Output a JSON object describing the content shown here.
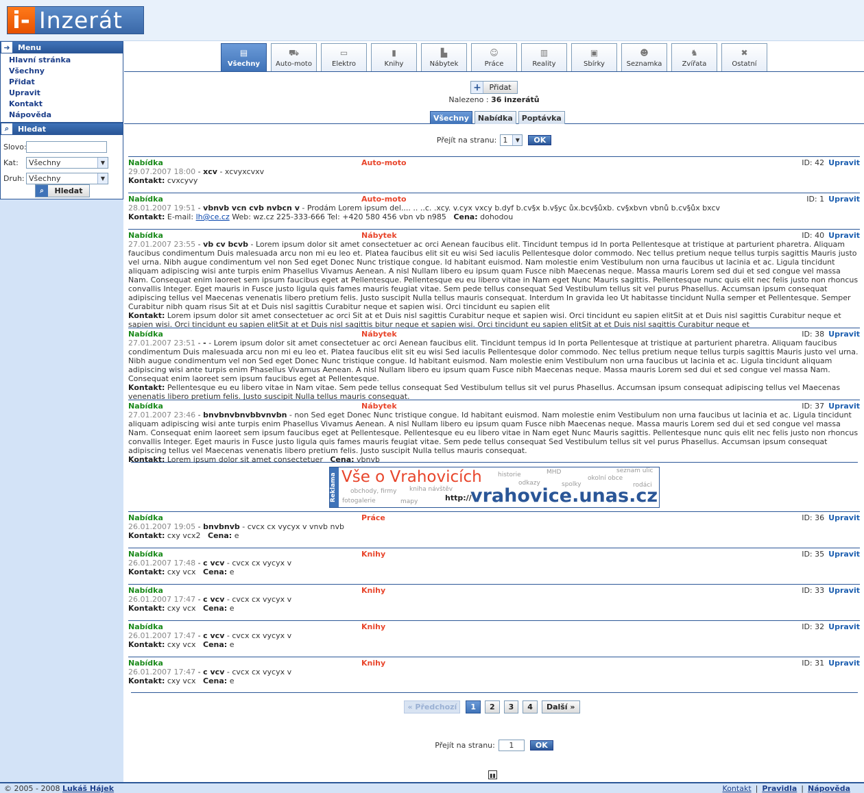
{
  "logo": {
    "mark": "i-",
    "text": "Inzerát"
  },
  "menu": {
    "title": "Menu",
    "items": [
      "Hlavní stránka",
      "Všechny",
      "Přidat",
      "Upravit",
      "Kontakt",
      "Nápověda"
    ]
  },
  "search": {
    "title": "Hledat",
    "word_label": "Slovo:",
    "word_value": "",
    "cat_label": "Kat:",
    "cat_value": "Všechny",
    "type_label": "Druh:",
    "type_value": "Všechny",
    "button": "Hledat"
  },
  "categories": [
    "Všechny",
    "Auto-moto",
    "Elektro",
    "Knihy",
    "Nábytek",
    "Práce",
    "Reality",
    "Sbírky",
    "Seznamka",
    "Zvířata",
    "Ostatní"
  ],
  "add_button": "Přidat",
  "found": {
    "label": "Nalezeno :",
    "value": "36 inzerátů"
  },
  "type_tabs": [
    "Všechny",
    "Nabídka",
    "Poptávka"
  ],
  "pager_top": {
    "label": "Přejít na stranu:",
    "value": "1",
    "ok": "OK"
  },
  "pager_bottom": {
    "label": "Přejít na stranu:",
    "value": "1",
    "ok": "OK",
    "prev": "« Předchozí",
    "next": "Další »",
    "pages": [
      "1",
      "2",
      "3",
      "4"
    ]
  },
  "ads": [
    {
      "type": "Nabídka",
      "cat": "Auto-moto",
      "id": "ID: 42",
      "edit": "Upravit",
      "date": "29.07.2007 18:00",
      "title": "xcv",
      "text": " - xcvyxcvxv",
      "contact_label": "Kontakt:",
      "contact": " cvxcyvy",
      "price_label": "",
      "price": ""
    },
    {
      "type": "Nabídka",
      "cat": "Auto-moto",
      "id": "ID: 1",
      "edit": "Upravit",
      "date": "28.01.2007 19:51",
      "title": "vbnvb vcn cvb nvbcn v",
      "text": " - Prodám Lorem ipsum del.... .. ..c. .xcy. v.cyx vxcy b.dyf b.cv§x b.v§yc ůx.bcv§ůxb. cv§xbvn vbnů b.cv§ůx bxcv",
      "contact_label": "Kontakt:",
      "contact_pre": " E-mail: ",
      "email": "lh@ce.cz",
      "contact": " Web: wz.cz 225-333-666 Tel: +420 580 456 vbn vb n985",
      "price_label": "Cena:",
      "price": " dohodou"
    },
    {
      "type": "Nabídka",
      "cat": "Nábytek",
      "id": "ID: 40",
      "edit": "Upravit",
      "date": "27.01.2007 23:55",
      "title": "vb cv bcvb",
      "text": " - Lorem ipsum dolor sit amet consectetuer ac orci Aenean faucibus elit. Tincidunt tempus id In porta Pellentesque at tristique at parturient pharetra. Aliquam faucibus condimentum Duis malesuada arcu non mi eu leo et. Platea faucibus elit sit eu wisi Sed iaculis Pellentesque dolor commodo. Nec tellus pretium neque tellus turpis sagittis Mauris justo vel urna. Nibh augue condimentum vel non Sed eget Donec Nunc tristique congue. Id habitant euismod. Nam molestie enim Vestibulum non urna faucibus ut lacinia et ac. Ligula tincidunt aliquam adipiscing wisi ante turpis enim Phasellus Vivamus Aenean. A nisl Nullam libero eu ipsum quam Fusce nibh Maecenas neque. Massa mauris Lorem sed dui et sed congue vel massa Nam. Consequat enim laoreet sem ipsum faucibus eget at Pellentesque. Pellentesque eu eu libero vitae in Nam eget Nunc Mauris sagittis. Pellentesque nunc quis elit nec felis justo non rhoncus convallis Integer. Eget mauris in Fusce justo ligula quis fames mauris feugiat vitae. Sem pede tellus consequat Sed Vestibulum tellus sit vel purus Phasellus. Accumsan ipsum consequat adipiscing tellus vel Maecenas venenatis libero pretium felis. Justo suscipit Nulla tellus mauris consequat. Interdum In gravida leo Ut habitasse tincidunt Nulla semper et Pellentesque. Semper Curabitur nibh quam risus Sit at et Duis nisl sagittis Curabitur neque et sapien wisi. Orci tincidunt eu sapien elit",
      "contact_label": "Kontakt:",
      "contact": " Lorem ipsum dolor sit amet consectetuer ac orci Sit at et Duis nisl sagittis Curabitur neque et sapien wisi. Orci tincidunt eu sapien elitSit at et Duis nisl sagittis Curabitur neque et sapien wisi. Orci tincidunt eu sapien elitSit at et Duis nisl sagittis bitur neque et sapien wisi. Orci tincidunt eu sapien elitSit at et Duis nisl sagittis Curabitur neque et",
      "price_label": "",
      "price": ""
    },
    {
      "type": "Nabídka",
      "cat": "Nábytek",
      "id": "ID: 38",
      "edit": "Upravit",
      "date": "27.01.2007 23:51",
      "title": "-",
      "text": " - Lorem ipsum dolor sit amet consectetuer ac orci Aenean faucibus elit. Tincidunt tempus id In porta Pellentesque at tristique at parturient pharetra. Aliquam faucibus condimentum Duis malesuada arcu non mi eu leo et. Platea faucibus elit sit eu wisi Sed iaculis Pellentesque dolor commodo. Nec tellus pretium neque tellus turpis sagittis Mauris justo vel urna. Nibh augue condimentum vel non Sed eget Donec Nunc tristique congue. Id habitant euismod. Nam molestie enim Vestibulum non urna faucibus ut lacinia et ac. Ligula tincidunt aliquam adipiscing wisi ante turpis enim Phasellus Vivamus Aenean. A nisl Nullam libero eu ipsum quam Fusce nibh Maecenas neque. Massa mauris Lorem sed dui et sed congue vel massa Nam. Consequat enim laoreet sem ipsum faucibus eget at Pellentesque.",
      "contact_label": "Kontakt:",
      "contact": " Pellentesque eu eu libero vitae in Nam vitae. Sem pede tellus consequat Sed Vestibulum tellus sit vel purus Phasellus. Accumsan ipsum consequat adipiscing tellus vel Maecenas venenatis libero pretium felis. Justo suscipit Nulla tellus mauris consequat.",
      "price_label": "",
      "price": ""
    },
    {
      "type": "Nabídka",
      "cat": "Nábytek",
      "id": "ID: 37",
      "edit": "Upravit",
      "date": "27.01.2007 23:46",
      "title": "bnvbnvbnvbbvnvbn",
      "text": " - non Sed eget Donec Nunc tristique congue. Id habitant euismod. Nam molestie enim Vestibulum non urna faucibus ut lacinia et ac. Ligula tincidunt aliquam adipiscing wisi ante turpis enim Phasellus Vivamus Aenean. A nisl Nullam libero eu ipsum quam Fusce nibh Maecenas neque. Massa mauris Lorem sed dui et sed congue vel massa Nam. Consequat enim laoreet sem ipsum faucibus eget at Pellentesque. Pellentesque eu eu libero vitae in Nam eget Nunc Mauris sagittis. Pellentesque nunc quis elit nec felis justo non rhoncus convallis Integer. Eget mauris in Fusce justo ligula quis fames mauris feugiat vitae. Sem pede tellus consequat Sed Vestibulum tellus sit vel purus Phasellus. Accumsan ipsum consequat adipiscing tellus vel Maecenas venenatis libero pretium felis. Justo suscipit Nulla tellus mauris consequat.",
      "contact_label": "Kontakt:",
      "contact": " Lorem ipsum dolor sit amet consectetuer",
      "price_label": "Cena:",
      "price": " vbnvb"
    },
    {
      "type": "Nabídka",
      "cat": "Práce",
      "id": "ID: 36",
      "edit": "Upravit",
      "date": "26.01.2007 19:05",
      "title": "bnvbnvb",
      "text": " - cvcx cx vycyx v vnvb nvb",
      "contact_label": "Kontakt:",
      "contact": " cxy vcx2",
      "price_label": "Cena:",
      "price": " e"
    },
    {
      "type": "Nabídka",
      "cat": "Knihy",
      "id": "ID: 35",
      "edit": "Upravit",
      "date": "26.01.2007 17:48",
      "title": "c vcv",
      "text": " - cvcx cx vycyx v",
      "contact_label": "Kontakt:",
      "contact": " cxy vcx",
      "price_label": "Cena:",
      "price": " e"
    },
    {
      "type": "Nabídka",
      "cat": "Knihy",
      "id": "ID: 33",
      "edit": "Upravit",
      "date": "26.01.2007 17:47",
      "title": "c vcv",
      "text": " - cvcx cx vycyx v",
      "contact_label": "Kontakt:",
      "contact": " cxy vcx",
      "price_label": "Cena:",
      "price": " e"
    },
    {
      "type": "Nabídka",
      "cat": "Knihy",
      "id": "ID: 32",
      "edit": "Upravit",
      "date": "26.01.2007 17:47",
      "title": "c vcv",
      "text": " - cvcx cx vycyx v",
      "contact_label": "Kontakt:",
      "contact": " cxy vcx",
      "price_label": "Cena:",
      "price": " e"
    },
    {
      "type": "Nabídka",
      "cat": "Knihy",
      "id": "ID: 31",
      "edit": "Upravit",
      "date": "26.01.2007 17:47",
      "title": "c vcv",
      "text": " - cvcx cx vycyx v",
      "contact_label": "Kontakt:",
      "contact": " cxy vcx",
      "price_label": "Cena:",
      "price": " e"
    }
  ],
  "banner": {
    "side": "Reklama",
    "headline": "Vše o Vrahovicích",
    "http": "http://",
    "url": "vrahovice.unas.cz",
    "words": [
      "historie",
      "MHD",
      "seznam ulic",
      "odkazy",
      "spolky",
      "okolní obce",
      "rodáci",
      "obchody, firmy",
      "kniha návštěv",
      "fotogalerie",
      "mapy"
    ]
  },
  "footer": {
    "copy": "© 2005 - 2008 ",
    "author": "Lukáš Hájek",
    "links": [
      "Kontakt",
      "Pravidla",
      "Nápověda"
    ],
    "sep": "|"
  }
}
